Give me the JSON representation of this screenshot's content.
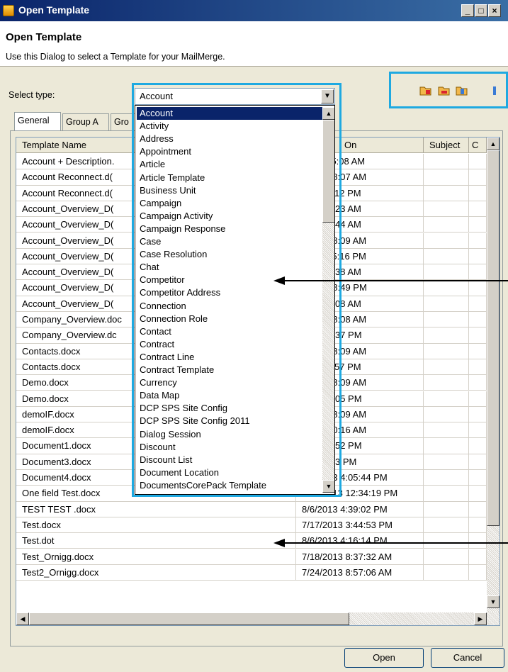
{
  "window": {
    "title": "Open Template"
  },
  "header": {
    "title": "Open Template",
    "description": "Use this Dialog to select a Template for your MailMerge."
  },
  "select_type": {
    "label": "Select type:",
    "value": "Account"
  },
  "tabs": [
    {
      "label": "General"
    },
    {
      "label": "Group A"
    },
    {
      "label": "Gro"
    }
  ],
  "grid": {
    "columns": [
      {
        "label": "Template Name"
      },
      {
        "label": "On"
      },
      {
        "label": "Subject"
      },
      {
        "label": "C"
      }
    ],
    "rows": [
      {
        "name": "Account + Description.",
        "date": "11 11:05:08 AM"
      },
      {
        "name": "Account Reconnect.d(",
        "date": "13 10:08:07 AM"
      },
      {
        "name": "Account Reconnect.d(",
        "date": "11 1:30:12 PM"
      },
      {
        "name": "Account_Overview_D(",
        "date": "13 7:52:23 AM"
      },
      {
        "name": "Account_Overview_D(",
        "date": "13 7:01:44 AM"
      },
      {
        "name": "Account_Overview_D(",
        "date": "13 10:08:09 AM"
      },
      {
        "name": "Account_Overview_D(",
        "date": "11 12:25:16 PM"
      },
      {
        "name": "Account_Overview_D(",
        "date": "13 9:18:38 AM"
      },
      {
        "name": "Account_Overview_D(",
        "date": "13 12:48:49 PM"
      },
      {
        "name": "Account_Overview_D(",
        "date": "3 10:21:08 AM"
      },
      {
        "name": "Company_Overview.doc",
        "date": "13 10:08:08 AM"
      },
      {
        "name": "Company_Overview.dc",
        "date": "1 12:51:37 PM"
      },
      {
        "name": "Contacts.docx",
        "date": "13 10:08:09 AM"
      },
      {
        "name": "Contacts.docx",
        "date": "11 3:14:57 PM"
      },
      {
        "name": "Demo.docx",
        "date": "13 10:08:09 AM"
      },
      {
        "name": "Demo.docx",
        "date": "12 4:03:05 PM"
      },
      {
        "name": "demoIF.docx",
        "date": "13 10:08:09 AM"
      },
      {
        "name": "demoIF.docx",
        "date": "13 10:00:16 AM"
      },
      {
        "name": "Document1.docx",
        "date": "13 1:24:52 PM"
      },
      {
        "name": "Document3.docx",
        "date": "3 3:59:43 PM"
      },
      {
        "name": "Document4.docx",
        "date": "8/6/2013 4:05:44 PM"
      },
      {
        "name": "One field Test.docx",
        "date": "7/18/2013 12:34:19 PM"
      },
      {
        "name": "TEST TEST .docx",
        "date": "8/6/2013 4:39:02 PM"
      },
      {
        "name": "Test.docx",
        "date": "7/17/2013 3:44:53 PM"
      },
      {
        "name": "Test.dot",
        "date": "8/6/2013 4:16:14 PM"
      },
      {
        "name": "Test_Ornigg.docx",
        "date": "7/18/2013 8:37:32 AM"
      },
      {
        "name": "Test2_Ornigg.docx",
        "date": "7/24/2013 8:57:06 AM"
      }
    ]
  },
  "dropdown": {
    "items": [
      "Account",
      "Activity",
      "Address",
      "Appointment",
      "Article",
      "Article Template",
      "Business Unit",
      "Campaign",
      "Campaign Activity",
      "Campaign Response",
      "Case",
      "Case Resolution",
      "Chat",
      "Competitor",
      "Competitor Address",
      "Connection",
      "Connection Role",
      "Contact",
      "Contract",
      "Contract Line",
      "Contract Template",
      "Currency",
      "Data Map",
      "DCP SPS Site Config",
      "DCP SPS Site Config 2011",
      "Dialog Session",
      "Discount",
      "Discount List",
      "Document Location",
      "DocumentsCorePack Template"
    ]
  },
  "buttons": {
    "open": "Open",
    "cancel": "Cancel"
  },
  "colors": {
    "highlight": "#1ea9e1",
    "selection": "#0a246a"
  },
  "toolbar_icons": [
    "folder-open-icon",
    "folder-icon",
    "folder-edit-icon",
    "info-icon"
  ]
}
